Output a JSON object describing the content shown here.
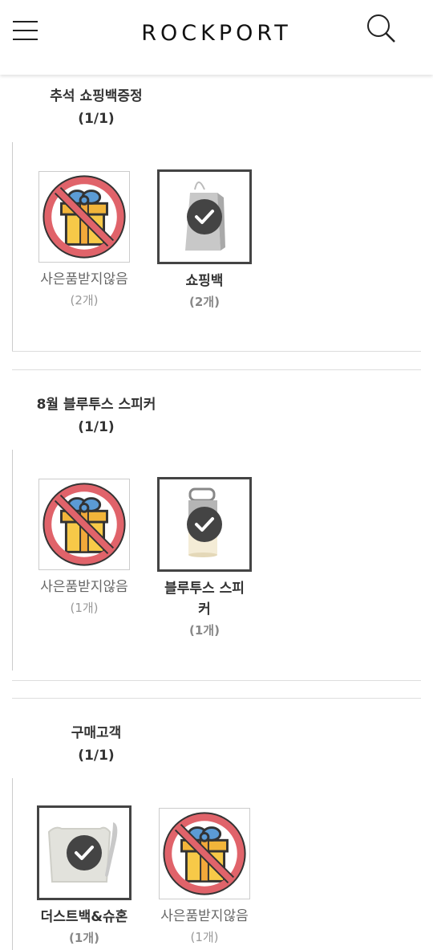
{
  "header": {
    "brand": "ROCKPORT"
  },
  "sections": [
    {
      "title": "추석 쇼핑백증정",
      "count": "(1/1)",
      "options": [
        {
          "name": "사은품받지않음",
          "qty": "(2개)",
          "selected": false,
          "icon": "no-gift-icon"
        },
        {
          "name": "쇼핑백",
          "qty": "(2개)",
          "selected": true,
          "icon": "shopping-bag"
        }
      ]
    },
    {
      "title": "8월 블루투스 스피커",
      "count": "(1/1)",
      "options": [
        {
          "name": "사은품받지않음",
          "qty": "(1개)",
          "selected": false,
          "icon": "no-gift-icon"
        },
        {
          "name": "블루투스 스피커",
          "name_line1": "블루투스 스피",
          "name_line2": "커",
          "qty": "(1개)",
          "selected": true,
          "icon": "bluetooth-speaker"
        }
      ]
    },
    {
      "title": "구매고객",
      "count": "(1/1)",
      "options": [
        {
          "name": "더스트백&슈혼",
          "qty": "(1개)",
          "selected": true,
          "icon": "dust-bag-shoehorn"
        },
        {
          "name": "사은품받지않음",
          "qty": "(1개)",
          "selected": false,
          "icon": "no-gift-icon"
        }
      ]
    }
  ],
  "colors": {
    "prohibit_red": "#d9373f",
    "gift_yellow": "#f7c948",
    "ribbon_blue": "#5b9bd5",
    "check_bg": "#444444"
  }
}
